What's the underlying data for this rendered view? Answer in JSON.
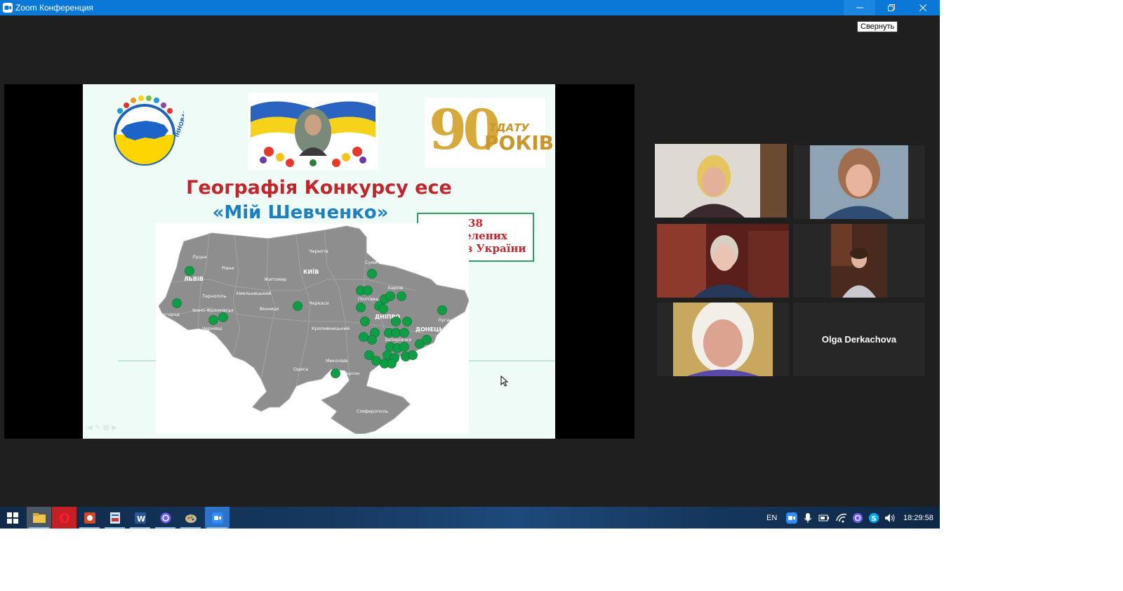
{
  "window": {
    "title": "Zoom Конференция",
    "tooltip": "Свернуть"
  },
  "slide": {
    "title_line1": "Географія Конкурсу есе",
    "title_line2": "«Мій Шевченко»",
    "count_number": "38",
    "count_line2": "населених",
    "count_line3": "пунктів України",
    "logo1_text": "ІННОВАЦІЙНІ ОБРІЇ УКРАЇНИ",
    "anniversary_number": "90",
    "anniversary_abbr": "ТДАТУ",
    "anniversary_word": "РОКІВ",
    "cities": [
      {
        "name": "Чернігів"
      },
      {
        "name": "Луцьк"
      },
      {
        "name": "Рівне"
      },
      {
        "name": "Суми"
      },
      {
        "name": "Житомир"
      },
      {
        "name": "КИЇВ"
      },
      {
        "name": "ЛЬВІВ"
      },
      {
        "name": "Харків"
      },
      {
        "name": "Тернопіль"
      },
      {
        "name": "Хмельницький"
      },
      {
        "name": "Полтава"
      },
      {
        "name": "Ужгород"
      },
      {
        "name": "Івано-Франківськ"
      },
      {
        "name": "Вінниця"
      },
      {
        "name": "Черкаси"
      },
      {
        "name": "Луганськ"
      },
      {
        "name": "ДНІПРО"
      },
      {
        "name": "Чернівці"
      },
      {
        "name": "Кропивницький"
      },
      {
        "name": "ДОНЕЦЬК"
      },
      {
        "name": "Запоріжжя"
      },
      {
        "name": "Миколаїв"
      },
      {
        "name": "Одеса"
      },
      {
        "name": "Херсон"
      },
      {
        "name": "Сімферополь"
      }
    ]
  },
  "participants": [
    {
      "id": "p1",
      "active": true
    },
    {
      "id": "p2"
    },
    {
      "id": "p3"
    },
    {
      "id": "p4"
    },
    {
      "id": "p5"
    },
    {
      "id": "p6",
      "name": "Olga Derkachova"
    }
  ],
  "taskbar": {
    "lang": "EN",
    "clock": "18:29:58",
    "apps": [
      "start-icon",
      "file-explorer-icon",
      "opera-icon",
      "powerpoint-icon",
      "file-manager-icon",
      "word-icon",
      "viber-icon",
      "paint-icon",
      "zoom-icon"
    ]
  },
  "colors": {
    "accent": "#0b78d7",
    "active_speaker": "#cbe27a",
    "map_dot": "#0f9d45",
    "map_fill": "#8e8e8e"
  }
}
